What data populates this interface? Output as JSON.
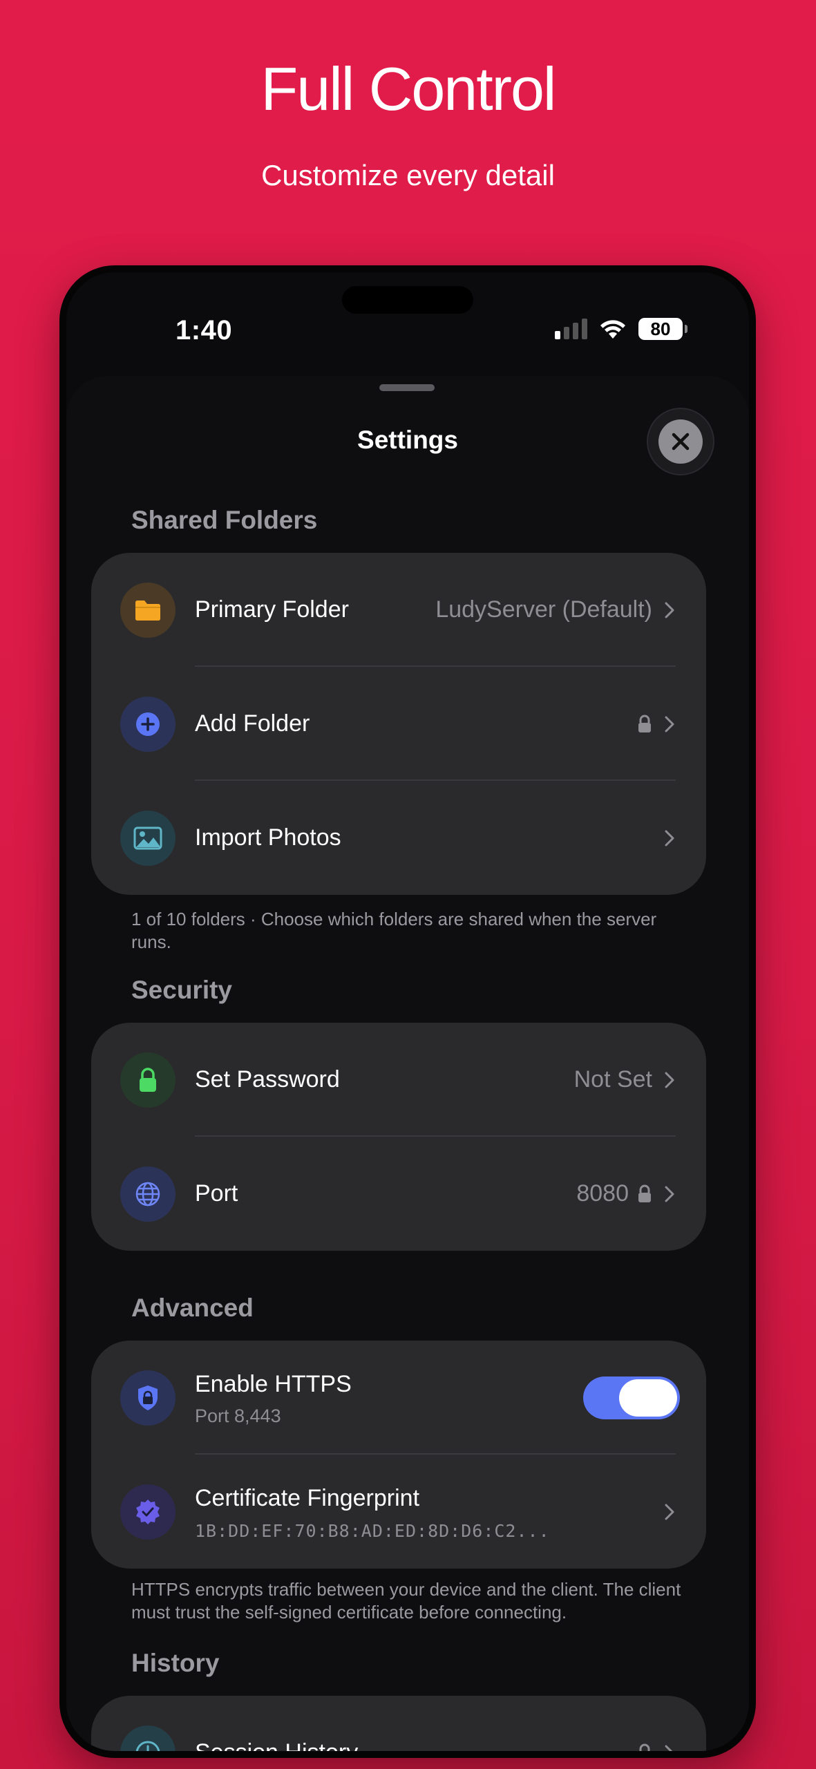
{
  "promo": {
    "title": "Full Control",
    "subtitle": "Customize every detail"
  },
  "status_bar": {
    "time": "1:40",
    "battery": "80"
  },
  "sheet": {
    "title": "Settings"
  },
  "sections": {
    "shared_folders": {
      "header": "Shared Folders",
      "rows": {
        "primary_folder": {
          "label": "Primary Folder",
          "value": "LudyServer (Default)",
          "icon": "folder-icon"
        },
        "add_folder": {
          "label": "Add Folder",
          "icon": "plus-circle-icon",
          "locked": true
        },
        "import_photos": {
          "label": "Import Photos",
          "icon": "photo-icon"
        }
      },
      "footer": "1 of 10 folders · Choose which folders are shared when the server runs."
    },
    "security": {
      "header": "Security",
      "rows": {
        "set_password": {
          "label": "Set Password",
          "value": "Not Set",
          "icon": "lock-icon"
        },
        "port": {
          "label": "Port",
          "value": "8080",
          "icon": "globe-icon",
          "locked": true
        }
      }
    },
    "advanced": {
      "header": "Advanced",
      "rows": {
        "enable_https": {
          "label": "Enable HTTPS",
          "sublabel": "Port 8,443",
          "icon": "shield-lock-icon",
          "enabled": true
        },
        "certificate_fingerprint": {
          "label": "Certificate Fingerprint",
          "sublabel": "1B:DD:EF:70:B8:AD:ED:8D:D6:C2...",
          "icon": "verified-badge-icon"
        }
      },
      "footer": "HTTPS encrypts traffic between your device and the client. The client must trust the self-signed certificate before connecting."
    },
    "history": {
      "header": "History",
      "rows": {
        "session_history": {
          "label": "Session History",
          "icon": "clock-icon",
          "locked": true
        }
      }
    }
  },
  "colors": {
    "background": "#e21c4a",
    "accent_toggle": "#5b76f5",
    "card": "#2a2a2d"
  }
}
